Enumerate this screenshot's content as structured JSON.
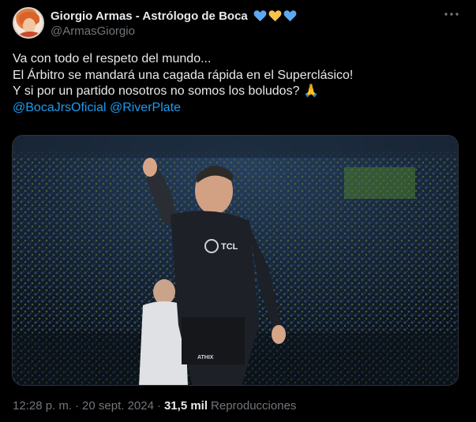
{
  "author": {
    "display_name": "Giorgio Armas - Astrólogo de Boca",
    "handle": "@ArmasGiorgio",
    "emoji_hearts": [
      "blue-heart",
      "yellow-heart",
      "blue-heart"
    ]
  },
  "colors": {
    "accent": "#1d9bf0",
    "muted": "#71767b",
    "text": "#e7e9ea",
    "background": "#000000",
    "heart_blue": "#5da8f0",
    "heart_yellow": "#f5c24b"
  },
  "tweet": {
    "lines": [
      "Va con todo el respeto del mundo...",
      "El Árbitro se mandará una cagada rápida en el Superclásico!",
      "Y si por un partido nosotros no somos los boludos?"
    ],
    "line3_emoji": "🙏",
    "mentions": [
      "@BocaJrsOficial",
      "@RiverPlate"
    ]
  },
  "media": {
    "sponsor_text": "TCL",
    "kit_brand": "ATHIX"
  },
  "meta": {
    "time": "12:28 p. m.",
    "separator1": "·",
    "date": "20 sept. 2024",
    "separator2": "·",
    "views_count": "31,5 mil",
    "views_label": "Reproducciones"
  },
  "icons": {
    "more": "more-dots-icon"
  }
}
